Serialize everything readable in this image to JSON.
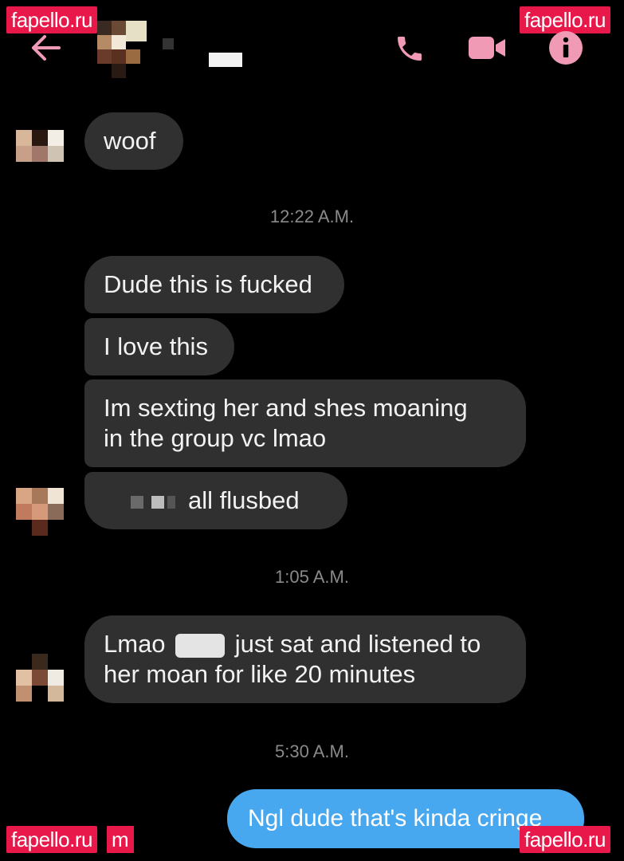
{
  "watermark": {
    "top_left": "fapello.ru",
    "top_right": "fapello.ru",
    "bottom_left": "fapello.ru",
    "bottom_left_partial": "m",
    "bottom_right": "fapello.ru"
  },
  "header": {
    "back_icon": "arrow-left-icon",
    "call_icon": "phone-icon",
    "video_icon": "video-camera-icon",
    "info_icon": "info-icon",
    "icon_color": "#f19ab6"
  },
  "messages": {
    "m1": "woof",
    "ts1": "12:22 A.M.",
    "m2": "Dude this is fucked",
    "m3": "I love this",
    "m4_line1": "Im sexting her and shes moaning",
    "m4_line2": "in the group vc lmao",
    "m5": "all flusbed",
    "ts2": "1:05 A.M.",
    "m6_a": "Lmao",
    "m6_b": "just sat and listened to",
    "m6_line2": "her moan for like 20 minutes",
    "ts3": "5:30 A.M.",
    "sent1": "Ngl dude that's kinda cringe"
  },
  "colors": {
    "background": "#000000",
    "incoming_bubble": "#303030",
    "outgoing_bubble": "#47a7ef",
    "watermark": "#e8184a"
  }
}
